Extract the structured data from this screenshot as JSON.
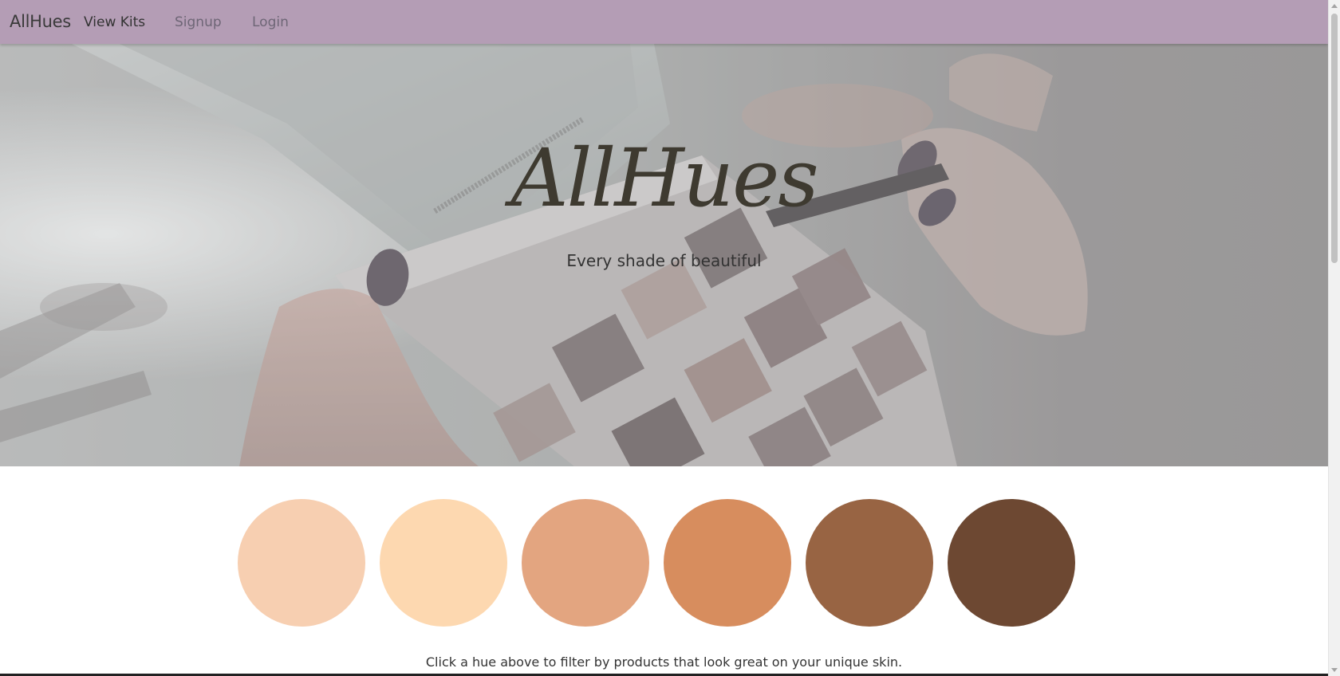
{
  "navbar": {
    "brand": "AllHues",
    "links": [
      "View Kits",
      "Signup",
      "Login"
    ],
    "background": "#b49db5"
  },
  "hero": {
    "title": "AllHues",
    "subtitle": "Every shade of beautiful",
    "image": "makeup-palette-photo"
  },
  "swatches": {
    "colors": [
      "#f7cfb1",
      "#fdd8b0",
      "#e3a580",
      "#d78d5e",
      "#986443",
      "#6d4832"
    ]
  },
  "hint": "Click a hue above to filter by products that look great on your unique skin."
}
